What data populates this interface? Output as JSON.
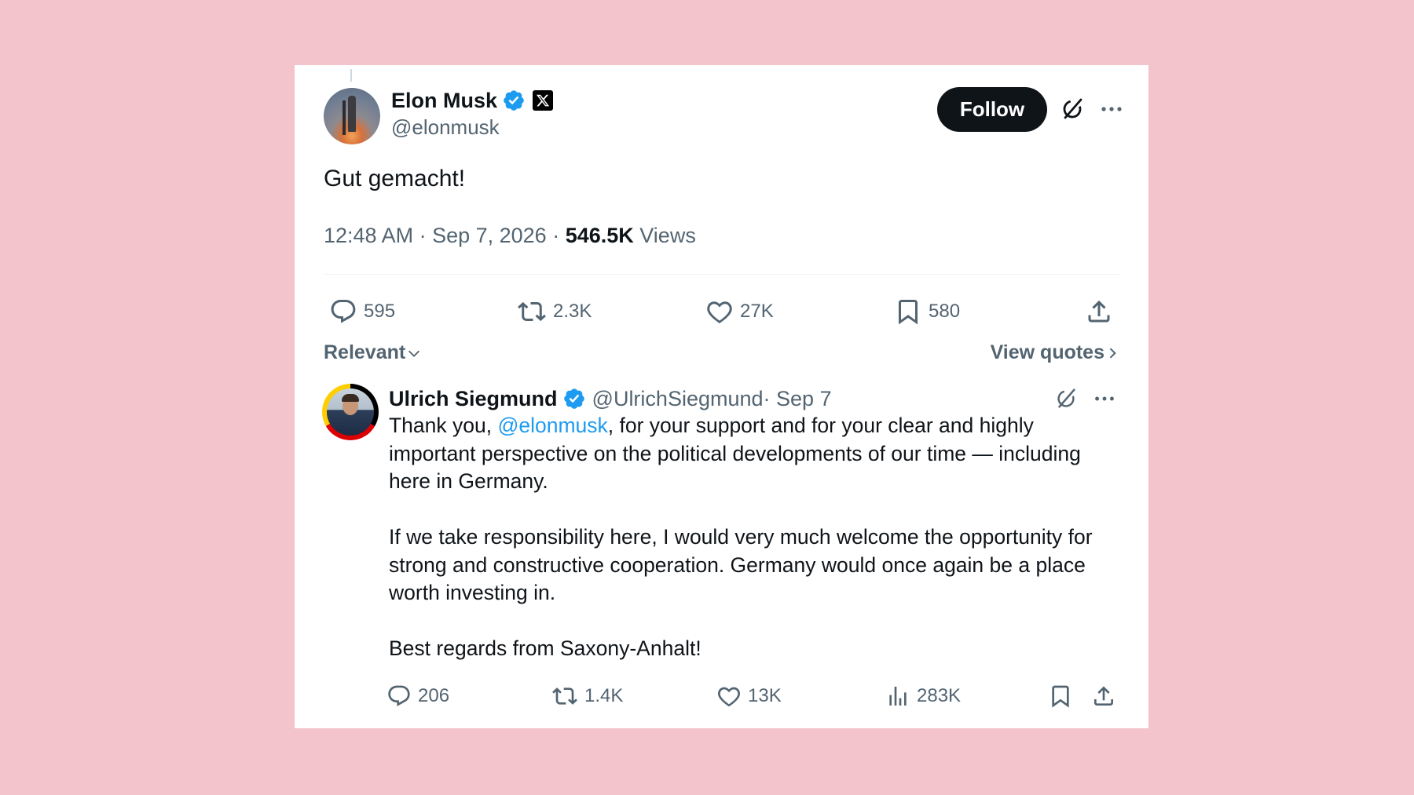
{
  "main_tweet": {
    "author_name": "Elon Musk",
    "author_handle": "@elonmusk",
    "follow_label": "Follow",
    "text": "Gut gemacht!",
    "time": "12:48 AM · Sep 7, 2026 · ",
    "views_count": "546.5K",
    "views_label": " Views",
    "replies": "595",
    "reposts": "2.3K",
    "likes": "27K",
    "bookmarks": "580"
  },
  "sort": {
    "relevant_label": "Relevant",
    "view_quotes_label": "View quotes"
  },
  "reply": {
    "author_name": "Ulrich Siegmund",
    "author_handle": "@UlrichSiegmund",
    "date": " · Sep 7",
    "text_prefix": "Thank you, ",
    "mention": "@elonmusk",
    "text_line1_rest": ", for your support and for your clear and highly important perspective on the political developments of our time — including here in Germany.",
    "paragraph2": "If we take responsibility here, I would very much welcome the opportunity for strong and constructive cooperation. Germany would once again be a place worth investing in.",
    "paragraph3": "Best regards from Saxony-Anhalt!",
    "replies": "206",
    "reposts": "1.4K",
    "likes": "13K",
    "views": "283K"
  },
  "colors": {
    "background": "#f3c4cb",
    "verified": "#1d9bf0",
    "mention": "#1d9bf0",
    "secondary_text": "#536471"
  },
  "icons": [
    "verified-icon",
    "x-logo-icon",
    "grok-icon",
    "more-icon",
    "reply-icon",
    "repost-icon",
    "like-icon",
    "bookmark-icon",
    "share-icon",
    "views-icon",
    "chevron-down-icon",
    "chevron-right-icon"
  ]
}
